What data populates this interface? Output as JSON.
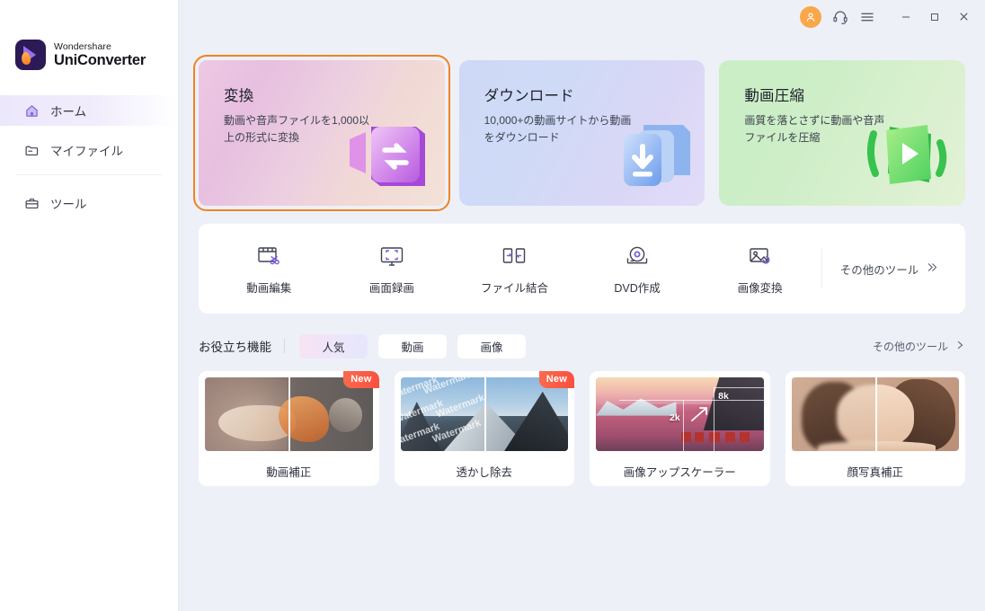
{
  "app": {
    "brand_line1": "Wondershare",
    "brand_line2": "UniConverter",
    "logo_icon": "uniconverter-logo-icon"
  },
  "titlebar": {
    "account_icon": "account-avatar-icon",
    "support_icon": "headset-support-icon",
    "menu_icon": "hamburger-menu-icon",
    "minimize_icon": "minimize-icon",
    "maximize_icon": "maximize-icon",
    "close_icon": "close-icon",
    "accent_avatar_color": "#f9a74a"
  },
  "sidebar": {
    "items": [
      {
        "label": "ホーム",
        "icon": "home-icon",
        "active": true
      },
      {
        "label": "マイファイル",
        "icon": "folder-icon",
        "active": false
      },
      {
        "label": "ツール",
        "icon": "toolbox-icon",
        "active": false
      }
    ]
  },
  "hero_cards": [
    {
      "title": "変換",
      "desc": "動画や音声ファイルを1,000以上の形式に変換",
      "icon": "convert-3d-icon",
      "selected": true,
      "accent": "#f08322"
    },
    {
      "title": "ダウンロード",
      "desc": "10,000+の動画サイトから動画をダウンロード",
      "icon": "download-3d-icon",
      "selected": false,
      "accent": "#5b86e5"
    },
    {
      "title": "動画圧縮",
      "desc": "画質を落とさずに動画や音声ファイルを圧縮",
      "icon": "compress-3d-icon",
      "selected": false,
      "accent": "#4caf50"
    }
  ],
  "tools": {
    "items": [
      {
        "label": "動画編集",
        "icon": "film-scissors-icon"
      },
      {
        "label": "画面録画",
        "icon": "monitor-record-icon"
      },
      {
        "label": "ファイル結合",
        "icon": "merge-files-icon"
      },
      {
        "label": "DVD作成",
        "icon": "dvd-disc-icon"
      },
      {
        "label": "画像変換",
        "icon": "image-convert-icon"
      }
    ],
    "more_label": "その他のツール",
    "more_icon": "double-chevron-right-icon"
  },
  "features": {
    "section_title": "お役立ち機能",
    "tabs": [
      {
        "label": "人気",
        "active": true
      },
      {
        "label": "動画",
        "active": false
      },
      {
        "label": "画像",
        "active": false
      }
    ],
    "more_label": "その他のツール",
    "more_icon": "chevron-right-icon",
    "cards": [
      {
        "label": "動画補正",
        "badge": "New",
        "thumb": "video-enhance-thumb"
      },
      {
        "label": "透かし除去",
        "badge": "New",
        "thumb": "watermark-remove-thumb",
        "watermark_text": "Watermark"
      },
      {
        "label": "画像アップスケーラー",
        "badge": "",
        "thumb": "image-upscaler-thumb",
        "upscale_from": "2k",
        "upscale_to": "8k"
      },
      {
        "label": "顔写真補正",
        "badge": "",
        "thumb": "face-enhance-thumb"
      }
    ]
  }
}
